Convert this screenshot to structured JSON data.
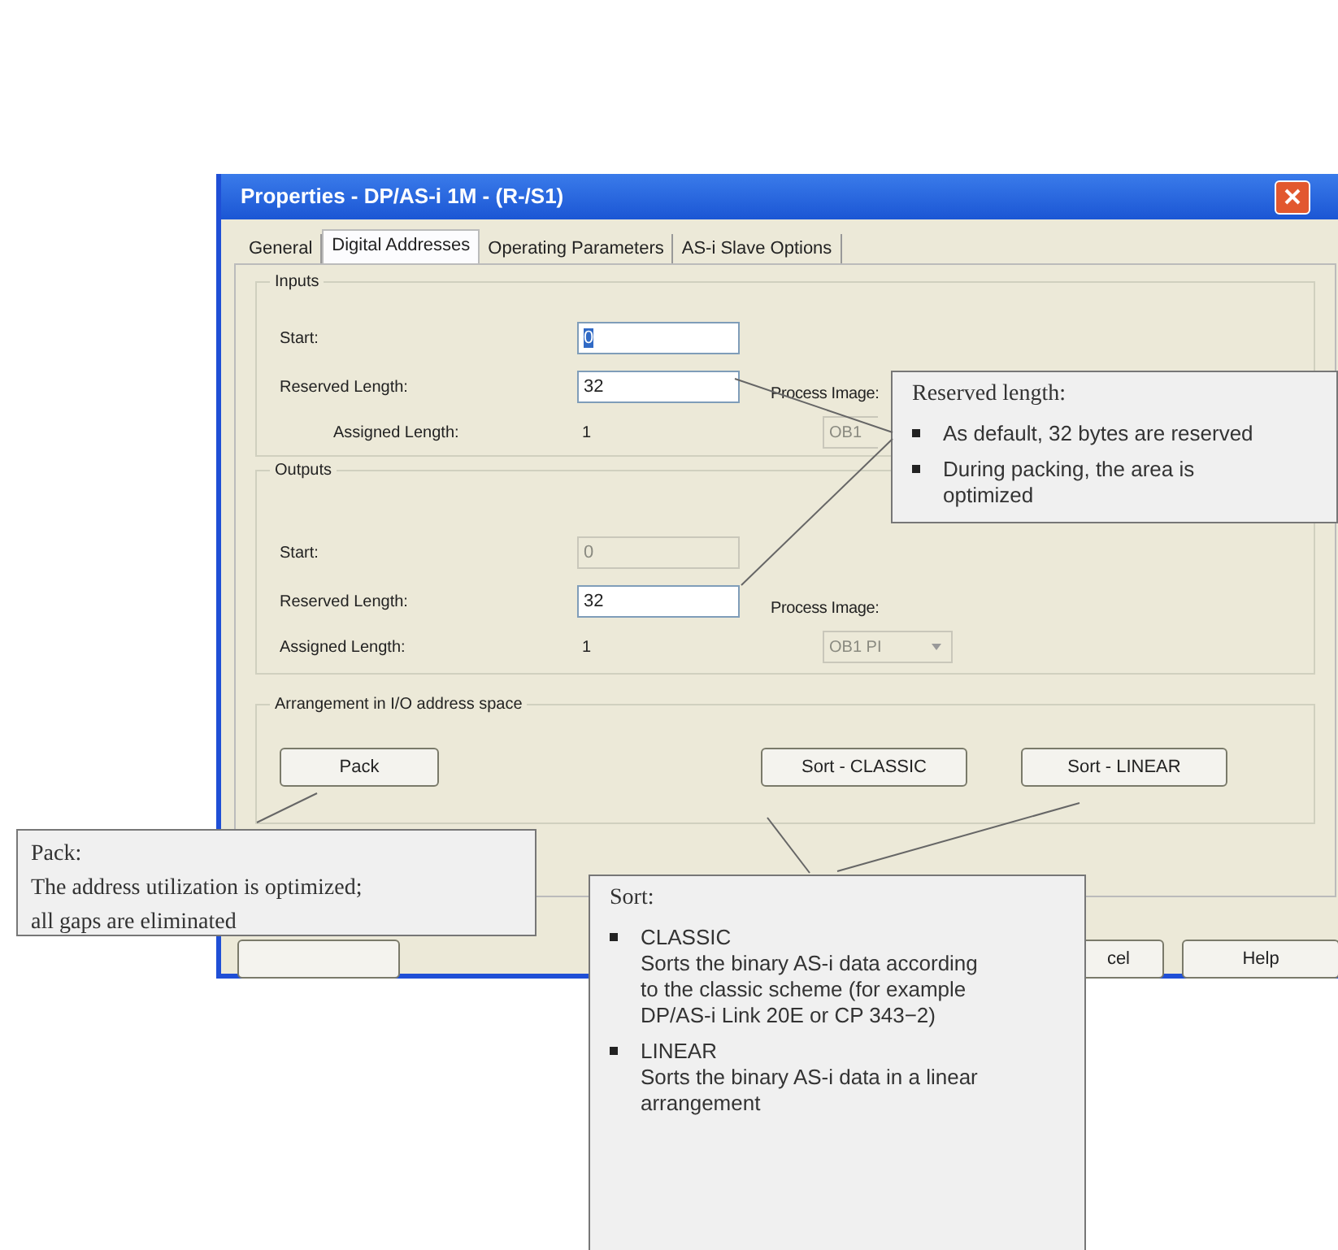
{
  "window": {
    "title": "Properties - DP/AS-i 1M - (R-/S1)"
  },
  "tabs": [
    {
      "label": "General",
      "selected": false
    },
    {
      "label": "Digital Addresses",
      "selected": true
    },
    {
      "label": "Operating Parameters",
      "selected": false
    },
    {
      "label": "AS-i Slave Options",
      "selected": false
    }
  ],
  "groups": [
    {
      "title": "Inputs",
      "start_label": "Start:",
      "start": {
        "value": "0",
        "highlighted": true,
        "disabled": false
      },
      "reserved_label": "Reserved Length:",
      "reserved": {
        "value": "32",
        "disabled": false
      },
      "assigned_label": "Assigned Length:",
      "assigned": "1",
      "indent_assigned": true,
      "process_image_label": "Process Image:",
      "process_image": {
        "value": "OB1",
        "disabled": true
      }
    },
    {
      "title": "Outputs",
      "start_label": "Start:",
      "start": {
        "value": "0",
        "highlighted": false,
        "disabled": true
      },
      "reserved_label": "Reserved Length:",
      "reserved": {
        "value": "32",
        "disabled": false
      },
      "assigned_label": "Assigned Length:",
      "assigned": "1",
      "indent_assigned": false,
      "process_image_label": "Process Image:",
      "process_image": {
        "value": "OB1 PI",
        "disabled": true
      }
    }
  ],
  "arrangement": {
    "title": "Arrangement in I/O address space",
    "buttons": [
      "Pack",
      "Sort - CLASSIC",
      "Sort - LINEAR"
    ]
  },
  "dialog_buttons": [
    "cel",
    "Help"
  ],
  "callouts": [
    {
      "kind": "bullets",
      "title": "Reserved length:",
      "items": [
        {
          "text": "As default, 32 bytes are reserved"
        },
        {
          "text": "During packing, the area is optimized"
        }
      ]
    },
    {
      "kind": "text",
      "title": "Pack:",
      "lines": [
        "The address utilization is optimized;",
        "all gaps are eliminated"
      ]
    },
    {
      "kind": "bullets",
      "title": "Sort:",
      "items": [
        {
          "head": "CLASSIC",
          "text": "Sorts the binary AS-i data according to the classic scheme (for example DP/AS-i Link 20E or CP 343−2)"
        },
        {
          "head": "LINEAR",
          "text": "Sorts the binary AS-i data in a linear arrangement"
        }
      ]
    }
  ]
}
